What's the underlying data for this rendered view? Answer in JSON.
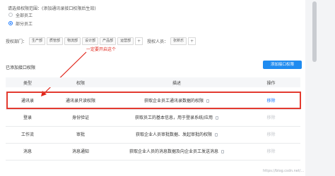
{
  "scope": {
    "title": "请选择权限范围：(添加通讯录接口权限后生效)",
    "options": [
      {
        "label": "全部员工",
        "selected": false
      },
      {
        "label": "部分员工",
        "selected": true
      }
    ]
  },
  "filters": {
    "dept_label": "授权部门：",
    "departments": [
      "生产部",
      "质管部",
      "物流部",
      "设计部",
      "产品部",
      "运营部"
    ],
    "person_label": "授权人员：",
    "persons": [
      "张新乐"
    ],
    "add_symbol": "+"
  },
  "annotation": {
    "text": "一定要开启这个",
    "color": "#e0261b"
  },
  "api_section": {
    "title": "已添加接口权限",
    "add_button": "添加接口权限",
    "columns": [
      "类型",
      "权限",
      "描述",
      "操作"
    ],
    "rows": [
      {
        "type": "通讯录",
        "permission": "通讯录只读权限",
        "description": "获取企业员工通讯录数据的权限",
        "action": "移除",
        "action_enabled": true,
        "highlighted": true
      },
      {
        "type": "登录",
        "permission": "身份验证",
        "description": "获取员工的基本信息，用于登录系统/应用",
        "action": "移除",
        "action_enabled": false,
        "highlighted": false
      },
      {
        "type": "工作流",
        "permission": "审批",
        "description": "获取企业人员审批数据、发起审批的权限",
        "action": "移除",
        "action_enabled": false,
        "highlighted": false
      },
      {
        "type": "消息",
        "permission": "消息通知",
        "description": "获取企业人员的消息数据及向企业员工发送消息",
        "action": "移除",
        "action_enabled": false,
        "highlighted": false
      }
    ]
  },
  "watermark": "https://blog.csdn.net/..."
}
